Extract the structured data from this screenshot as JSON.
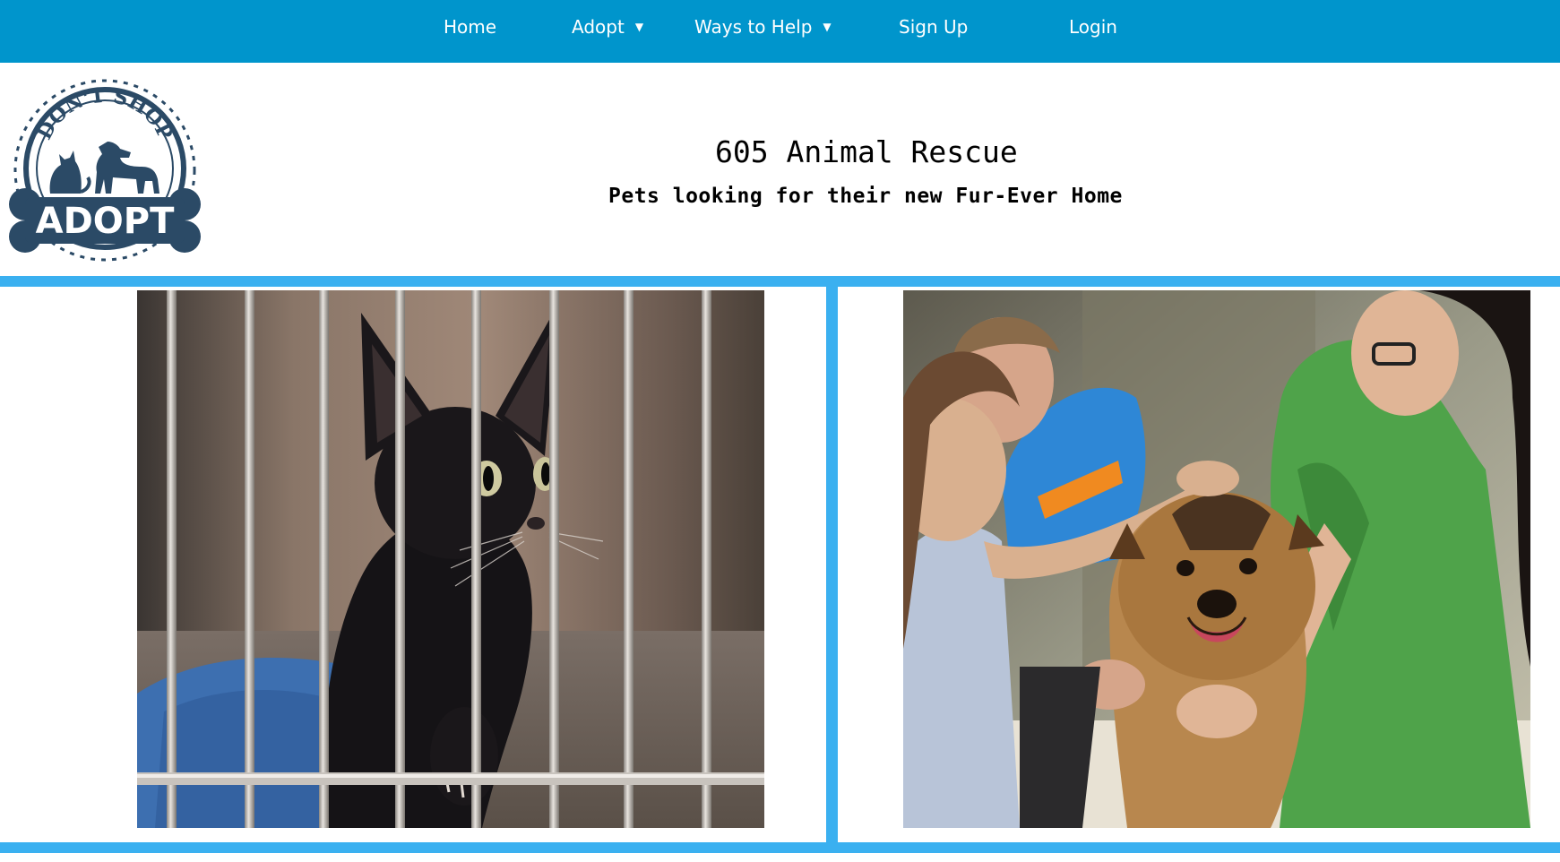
{
  "nav": {
    "home": "Home",
    "adopt": "Adopt",
    "ways_to_help": "Ways to Help",
    "sign_up": "Sign Up",
    "login": "Login",
    "caret": "▼"
  },
  "header": {
    "title": "605 Animal Rescue",
    "subtitle": "Pets looking for their new Fur-Ever Home"
  },
  "logo": {
    "top_text": "DON'T SHOP",
    "bottom_text": "ADOPT"
  },
  "colors": {
    "nav_bg": "#0095cc",
    "frame": "#3ab0f0",
    "logo": "#2b4a66"
  }
}
